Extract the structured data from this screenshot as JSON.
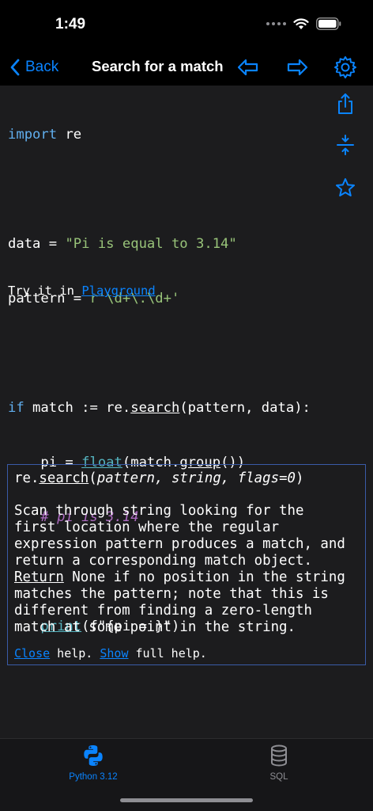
{
  "status": {
    "time": "1:49"
  },
  "nav": {
    "back_label": "Back",
    "title": "Search for a match"
  },
  "code": {
    "line1": {
      "a": "import",
      "b": " re"
    },
    "line3": {
      "a": "data = ",
      "b": "\"Pi is equal to 3.14\""
    },
    "line4": {
      "a": "pattern = ",
      "b": "r'\\d+\\.\\d+'"
    },
    "line6": {
      "a": "if",
      "b": " match := re.",
      "c": "search",
      "d": "(pattern, data):"
    },
    "line7": {
      "a": "    pi = ",
      "b": "float",
      "c": "(match.",
      "d": "group",
      "e": "())"
    },
    "line8": {
      "a": "    # pi is 3.14"
    },
    "line10": {
      "a": "    ",
      "b": "print",
      "c": "(f\"{pi = }\")"
    }
  },
  "try_line": {
    "prefix": "Try it in ",
    "link": "Playground"
  },
  "help": {
    "sig_prefix": "re.",
    "sig_func": "search",
    "sig_open": "(",
    "sig_args": "pattern, string, flags=0",
    "sig_close": ")",
    "desc_lines": [
      "Scan through string looking for the",
      "first location where the regular",
      "expression pattern produces a match, and",
      "return a corresponding match object."
    ],
    "return_word": "Return",
    "desc_rest": [
      " None if no position in the string",
      "matches the pattern; note that this is",
      "different from finding a zero-length",
      "match at some point in the string."
    ],
    "close_link": "Close",
    "close_text": " help. ",
    "show_link": "Show",
    "show_text": " full help."
  },
  "tabs": [
    {
      "label": "Python 3.12",
      "icon": "python-icon",
      "active": true
    },
    {
      "label": "SQL",
      "icon": "database-icon",
      "active": false
    }
  ],
  "colors": {
    "accent": "#0a84ff",
    "background": "#1c1c1e"
  }
}
